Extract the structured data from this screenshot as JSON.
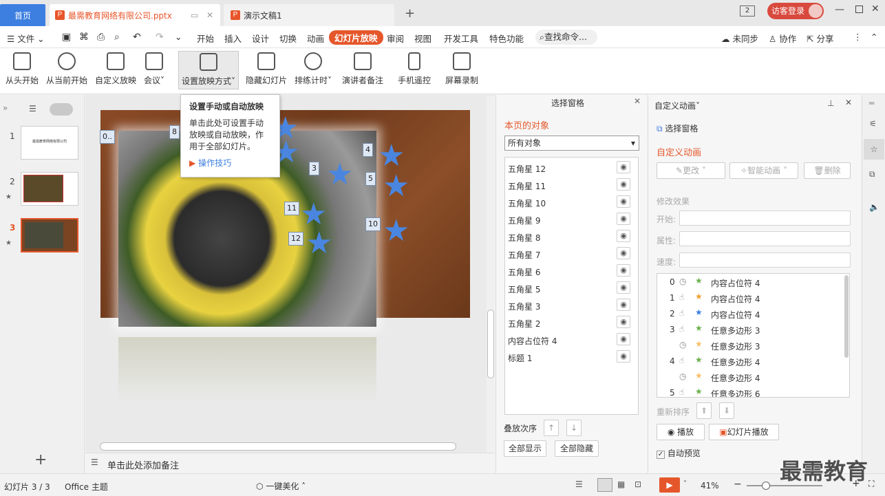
{
  "tabs": {
    "home": "首页",
    "file1": "最需教育网络有限公司.pptx",
    "file2": "演示文稿1",
    "page_count": "2",
    "guest_login": "访客登录"
  },
  "menu": {
    "file": "文件",
    "items": [
      "开始",
      "插入",
      "设计",
      "切换",
      "动画",
      "幻灯片放映",
      "审阅",
      "视图",
      "开发工具",
      "特色功能"
    ],
    "search": "查找命令...",
    "sync": "未同步",
    "collab": "协作",
    "share": "分享"
  },
  "ribbon": {
    "from_start": "从头开始",
    "from_current": "从当前开始",
    "custom_show": "自定义放映",
    "meeting": "会议",
    "setup_show": "设置放映方式",
    "hide_slide": "隐藏幻灯片",
    "rehearse": "排练计时",
    "presenter_notes": "演讲者备注",
    "phone_remote": "手机遥控",
    "screen_record": "屏幕录制"
  },
  "tooltip": {
    "title": "设置手动或自动放映",
    "body": "单击此处可设置手动放映或自动放映，作用于全部幻灯片。",
    "link": "操作技巧"
  },
  "thumbs": {
    "n1": "1",
    "n2": "2",
    "n3": "3",
    "t1_title": "最需教育网络有限公司"
  },
  "slide": {
    "labels": [
      "0..",
      "8",
      "4",
      "3",
      "5",
      "11",
      "10",
      "12"
    ]
  },
  "notes": {
    "placeholder": "单击此处添加备注"
  },
  "selpane": {
    "title": "选择窗格",
    "subtitle": "本页的对象",
    "filter": "所有对象",
    "objects": [
      "五角星 12",
      "五角星 11",
      "五角星 10",
      "五角星 9",
      "五角星 8",
      "五角星 7",
      "五角星 6",
      "五角星 5",
      "五角星 3",
      "五角星 2",
      "内容占位符 4",
      "标题 1"
    ],
    "order": "叠放次序",
    "show_all": "全部显示",
    "hide_all": "全部隐藏"
  },
  "animpane": {
    "title": "自定义动画",
    "sel_pane": "选择窗格",
    "section": "自定义动画",
    "change": "更改",
    "smart": "智能动画",
    "delete": "删除",
    "modify": "修改效果",
    "start": "开始:",
    "property": "属性:",
    "speed": "速度:",
    "reorder": "重新排序",
    "play": "播放",
    "slideshow": "幻灯片播放",
    "autopreview": "自动预览",
    "items": [
      {
        "n": "0",
        "name": "内容占位符 4"
      },
      {
        "n": "1",
        "name": "内容占位符 4"
      },
      {
        "n": "2",
        "name": "内容占位符 4"
      },
      {
        "n": "3",
        "name": "任意多边形 3"
      },
      {
        "n": "",
        "name": "任意多边形 3"
      },
      {
        "n": "4",
        "name": "任意多边形 4"
      },
      {
        "n": "",
        "name": "任意多边形 4"
      },
      {
        "n": "5",
        "name": "任意多边形 6"
      }
    ]
  },
  "status": {
    "slide": "幻灯片 3 / 3",
    "theme": "Office 主题",
    "beautify": "一键美化",
    "zoom": "41%",
    "watermark": "最需教育"
  },
  "colors": {
    "accent": "#e5572b",
    "blue": "#3d7fe0",
    "star": "#4a86e0"
  }
}
